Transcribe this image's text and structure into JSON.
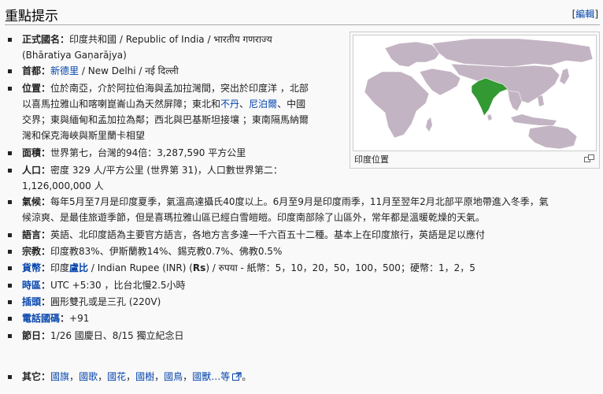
{
  "header": {
    "title": "重點提示",
    "edit_label": "編輯"
  },
  "map": {
    "caption": "印度位置"
  },
  "rows": {
    "name": {
      "key": "正式國名",
      "line1": "印度共和國 / Republic of India / भारतीय गणराज्य",
      "line2": "(Bhāratiya Gaṇarājya)"
    },
    "capital": {
      "key": "首都",
      "link": "新德里",
      "rest": " / New Delhi / नई दिल्ली"
    },
    "location": {
      "key": "位置",
      "line1": "位於南亞，介於阿拉伯海與孟加拉灣間，突出於印度洋 ，北部",
      "line2": "以喜馬拉雅山和喀喇崑崙山為天然屏障；東北和",
      "link_bhutan": "不丹",
      "sep": "、",
      "link_nepal": "尼泊爾",
      "line2_end": "、中國",
      "line3": "交界；東與緬甸和孟加拉為鄰；西北與巴基斯坦接壤 ；東南隔馬納爾",
      "line4": "灣和保克海峽與斯里蘭卡相望"
    },
    "area": {
      "key": "面積",
      "value": "世界第七，台灣的94倍：3,287,590 平方公里"
    },
    "population": {
      "key": "人口",
      "line1": "密度 329 人/平方公里 (世界第 31)，人口數世界第二：",
      "line2": "1,126,000,000 人"
    },
    "climate": {
      "key": "氣候",
      "line1": "每年5月至7月是印度夏季，氣溫高達攝氏40度以上。6月至9月是印度雨季，11月至翌年2月北部平原地帶進入冬季，氣",
      "line2": "候涼爽、是最佳旅遊季節，但是喜瑪拉雅山區已經白雪皚皚。印度南部除了山區外，常年都是溫暖乾燥的天氣。"
    },
    "language": {
      "key": "語言",
      "value": "英語、北印度語為主要官方語言，各地方言多達一千六百五十二種。基本上在印度旅行，英語是足以應付"
    },
    "religion": {
      "key": "宗教",
      "value": "印度教83%、伊斯蘭教14%、錫克教0.7%、佛教0.5%"
    },
    "currency": {
      "key": "貨幣",
      "key_link": "貨幣",
      "value1": "印度",
      "value_link": "盧比",
      "value2": " / Indian Rupee (INR) (",
      "rs": "Rs",
      "value3": ") / रुपया - 紙幣：5，10，20，50，100，500；硬幣：1，2，5"
    },
    "timezone": {
      "key": "時區",
      "value": "UTC +5:30 ，比台北慢2.5小時"
    },
    "plug": {
      "key": "插頭",
      "value": "圓形雙孔或是三孔 (220V)"
    },
    "phone": {
      "key": "電話國碼",
      "value": "+91"
    },
    "holiday": {
      "key": "節日",
      "value": "1/26 國慶日、8/15 獨立紀念日"
    },
    "other": {
      "key": "其它",
      "links": [
        "國旗",
        "國歌",
        "國花",
        "國樹",
        "國鳥",
        "國獸…等"
      ]
    }
  },
  "colors": {
    "india": "#339933",
    "land": "#c3b4c3",
    "ocean": "#ffffff",
    "link": "#0645ad"
  }
}
